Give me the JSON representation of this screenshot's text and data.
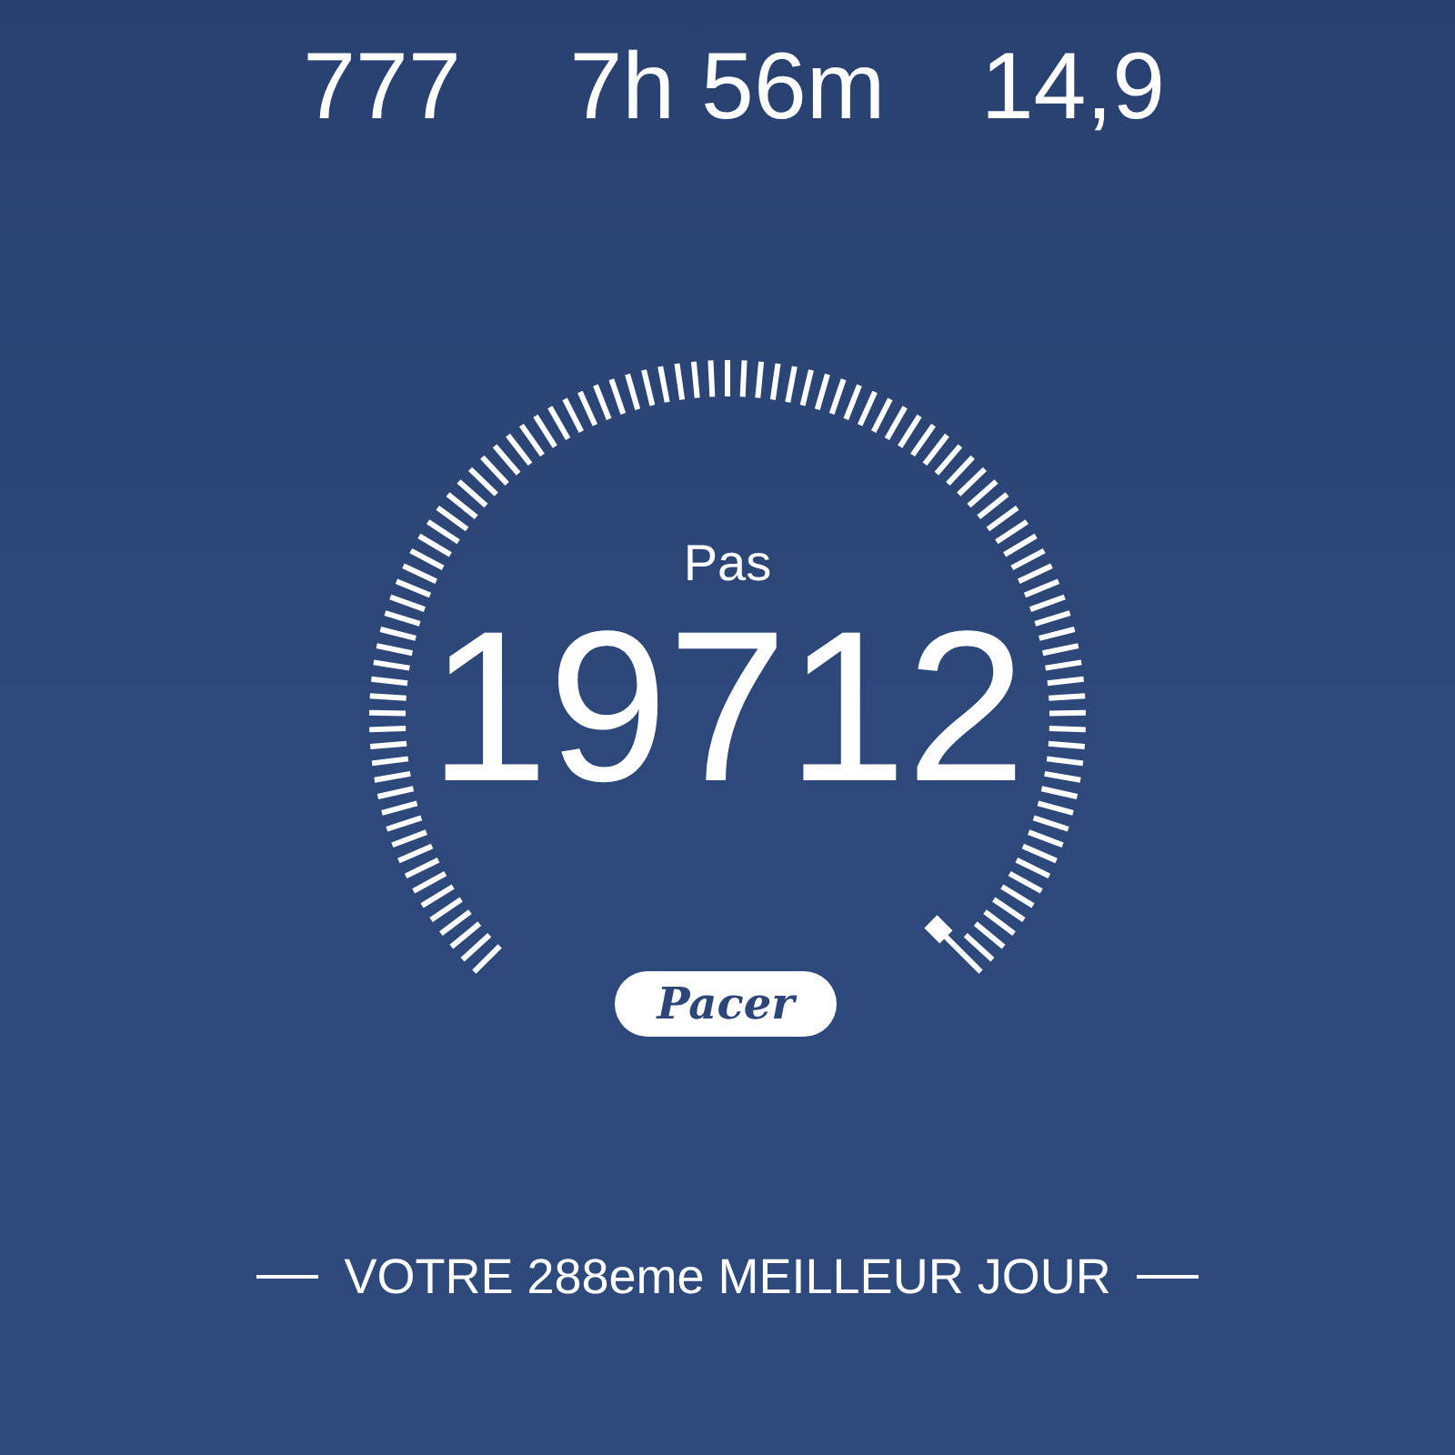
{
  "stats": [
    {
      "value": "777"
    },
    {
      "value": "7h 56m"
    },
    {
      "value": "14,9"
    }
  ],
  "gauge": {
    "label": "Pas",
    "value": "19712"
  },
  "logo": "Pacer",
  "footer": "VOTRE 288eme MEILLEUR JOUR"
}
